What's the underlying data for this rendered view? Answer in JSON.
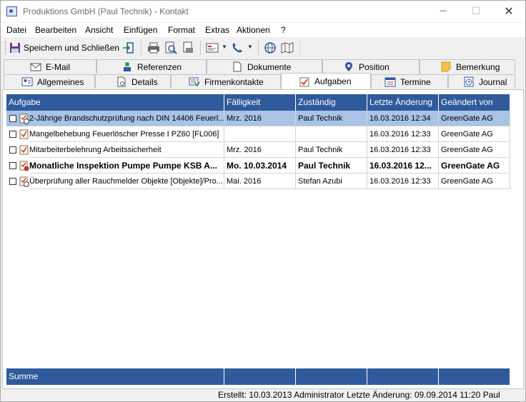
{
  "window": {
    "title": "Produktions GmbH (Paul Technik) - Kontakt",
    "minimize": "─",
    "maximize": "☐",
    "close": "✕"
  },
  "menu": {
    "items": [
      "Datei",
      "Bearbeiten",
      "Ansicht",
      "Einfügen",
      "Format",
      "Extras",
      "Aktionen",
      "?"
    ]
  },
  "toolbar": {
    "save_label": "Speichern und Schließen"
  },
  "tabs": {
    "top": [
      {
        "label": "E-Mail",
        "icon": "mail-icon"
      },
      {
        "label": "Referenzen",
        "icon": "references-icon"
      },
      {
        "label": "Dokumente",
        "icon": "document-icon"
      },
      {
        "label": "Position",
        "icon": "location-pin-icon"
      },
      {
        "label": "Bemerkung",
        "icon": "note-icon"
      }
    ],
    "bottom": [
      {
        "label": "Allgemeines",
        "icon": "contact-card-icon"
      },
      {
        "label": "Details",
        "icon": "details-icon"
      },
      {
        "label": "Firmenkontakte",
        "icon": "company-contacts-icon"
      },
      {
        "label": "Aufgaben",
        "icon": "task-icon"
      },
      {
        "label": "Termine",
        "icon": "calendar-icon"
      },
      {
        "label": "Journal",
        "icon": "journal-icon"
      }
    ],
    "active": "Aufgaben"
  },
  "table": {
    "columns": [
      "Aufgabe",
      "Fälligkeit",
      "Zuständig",
      "Letzte Änderung",
      "Geändert von"
    ],
    "rows": [
      {
        "aufgabe": "2-Jährige Brandschutzprüfung nach DIN 14406 Feuerl...",
        "faelligkeit": "Mrz. 2016",
        "zustaendig": "Paul Technik",
        "letzte_aenderung": "16.03.2016 12:34",
        "geaendert_von": "GreenGate AG",
        "selected": true,
        "bold": false,
        "icon": "recurring-task-icon"
      },
      {
        "aufgabe": "Mangelbehebung Feuerlöscher Presse I PZ60 [FL006]",
        "faelligkeit": "",
        "zustaendig": "",
        "letzte_aenderung": "16.03.2016 12:33",
        "geaendert_von": "GreenGate AG",
        "selected": false,
        "bold": false,
        "icon": "task-icon"
      },
      {
        "aufgabe": "Mitarbeiterbelehrung Arbeitssicherheit",
        "faelligkeit": "Mrz. 2016",
        "zustaendig": "Paul Technik",
        "letzte_aenderung": "16.03.2016 12:33",
        "geaendert_von": "GreenGate AG",
        "selected": false,
        "bold": false,
        "icon": "task-icon"
      },
      {
        "aufgabe": "Monatliche Inspektion Pumpe Pumpe KSB A...",
        "faelligkeit": "Mo. 10.03.2014",
        "zustaendig": "Paul Technik",
        "letzte_aenderung": "16.03.2016 12...",
        "geaendert_von": "GreenGate AG",
        "selected": false,
        "bold": true,
        "icon": "overdue-recurring-task-icon"
      },
      {
        "aufgabe": "Überprüfung aller Rauchmelder Objekte [Objekte]/Pro...",
        "faelligkeit": "Mai. 2016",
        "zustaendig": "Stefan Azubi",
        "letzte_aenderung": "16.03.2016 12:33",
        "geaendert_von": "GreenGate AG",
        "selected": false,
        "bold": false,
        "icon": "recurring-task-icon"
      }
    ],
    "summary_label": "Summe"
  },
  "status": {
    "text": "Erstellt: 10.03.2013 Administrator  Letzte Änderung: 09.09.2014 11:20 Paul"
  }
}
